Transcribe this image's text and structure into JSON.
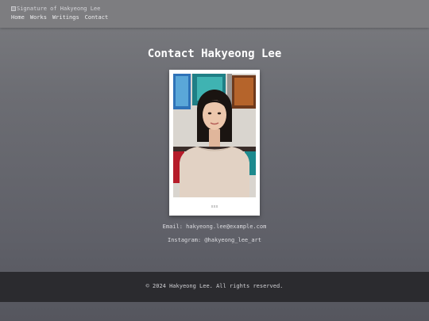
{
  "header": {
    "logo_alt": "Signature of Hakyeong Lee",
    "nav": [
      "Home",
      "Works",
      "Writings",
      "Contact"
    ]
  },
  "page": {
    "title": "Contact Hakyeong Lee"
  },
  "portrait": {
    "caption": "xxx"
  },
  "contact": {
    "email": "Email: hakyeong.lee@example.com",
    "instagram": "Instagram: @hakyeong_lee_art"
  },
  "footer": {
    "text": "© 2024 Hakyeong Lee. All rights reserved."
  },
  "colors": {
    "header_bg": "#7d7d80",
    "footer_bg": "#2b2b2f",
    "title": "#ffffff"
  }
}
